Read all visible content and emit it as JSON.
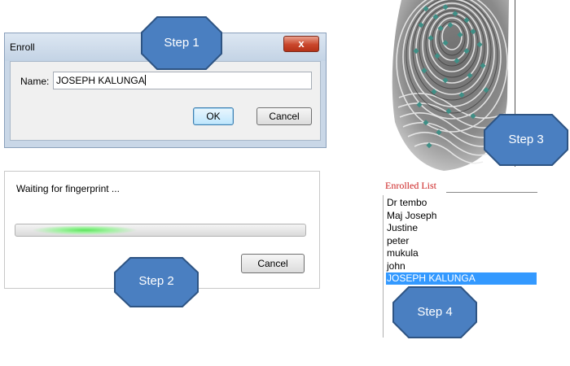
{
  "enroll_dialog": {
    "title": "Enroll",
    "close_symbol": "x",
    "name_label": "Name:",
    "name_value": "JOSEPH KALUNGA",
    "ok_label": "OK",
    "cancel_label": "Cancel"
  },
  "waiting_dialog": {
    "message": "Waiting for fingerprint ...",
    "progress_state": "indeterminate",
    "progress_color": "#5de65d",
    "cancel_label": "Cancel"
  },
  "fingerprint": {
    "minutiae_color": "#3f8f86"
  },
  "enrolled_list": {
    "title": "Enrolled List",
    "title_color": "#cc2222",
    "items": [
      "Dr tembo",
      "Maj Joseph",
      "Justine",
      "peter",
      "mukula",
      "john",
      "JOSEPH KALUNGA"
    ],
    "selected_item": "JOSEPH KALUNGA",
    "selection_color": "#3399ff"
  },
  "steps": {
    "step1": "Step 1",
    "step2": "Step 2",
    "step3": "Step 3",
    "step4": "Step 4",
    "fill_color": "#4a7fc1",
    "border_color": "#2e5483"
  }
}
